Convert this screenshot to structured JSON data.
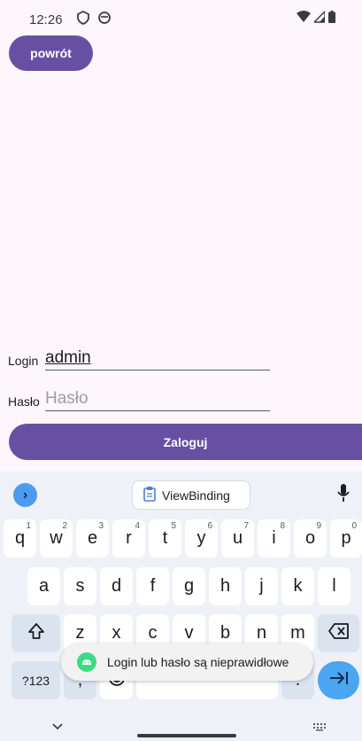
{
  "status_bar": {
    "time": "12:26"
  },
  "toolbar": {
    "back_label": "powrót"
  },
  "form": {
    "login_label": "Login",
    "login_value": "admin",
    "password_label": "Hasło",
    "password_placeholder": "Hasło",
    "submit_label": "Zaloguj"
  },
  "keyboard": {
    "suggestion": "ViewBinding",
    "row1": [
      {
        "key": "q",
        "hint": "1"
      },
      {
        "key": "w",
        "hint": "2"
      },
      {
        "key": "e",
        "hint": "3"
      },
      {
        "key": "r",
        "hint": "4"
      },
      {
        "key": "t",
        "hint": "5"
      },
      {
        "key": "y",
        "hint": "6"
      },
      {
        "key": "u",
        "hint": "7"
      },
      {
        "key": "i",
        "hint": "8"
      },
      {
        "key": "o",
        "hint": "9"
      },
      {
        "key": "p",
        "hint": "0"
      }
    ],
    "row2": [
      "a",
      "s",
      "d",
      "f",
      "g",
      "h",
      "j",
      "k",
      "l"
    ],
    "row3": [
      "z",
      "x",
      "c",
      "v",
      "b",
      "n",
      "m"
    ],
    "symbols_label": "?123",
    "comma_key": ",",
    "period_key": "."
  },
  "toast": {
    "message": "Login lub hasło są nieprawidłowe"
  },
  "colors": {
    "primary": "#6750a4",
    "background": "#fdf7fd",
    "keyboard": "#eef1f8"
  }
}
